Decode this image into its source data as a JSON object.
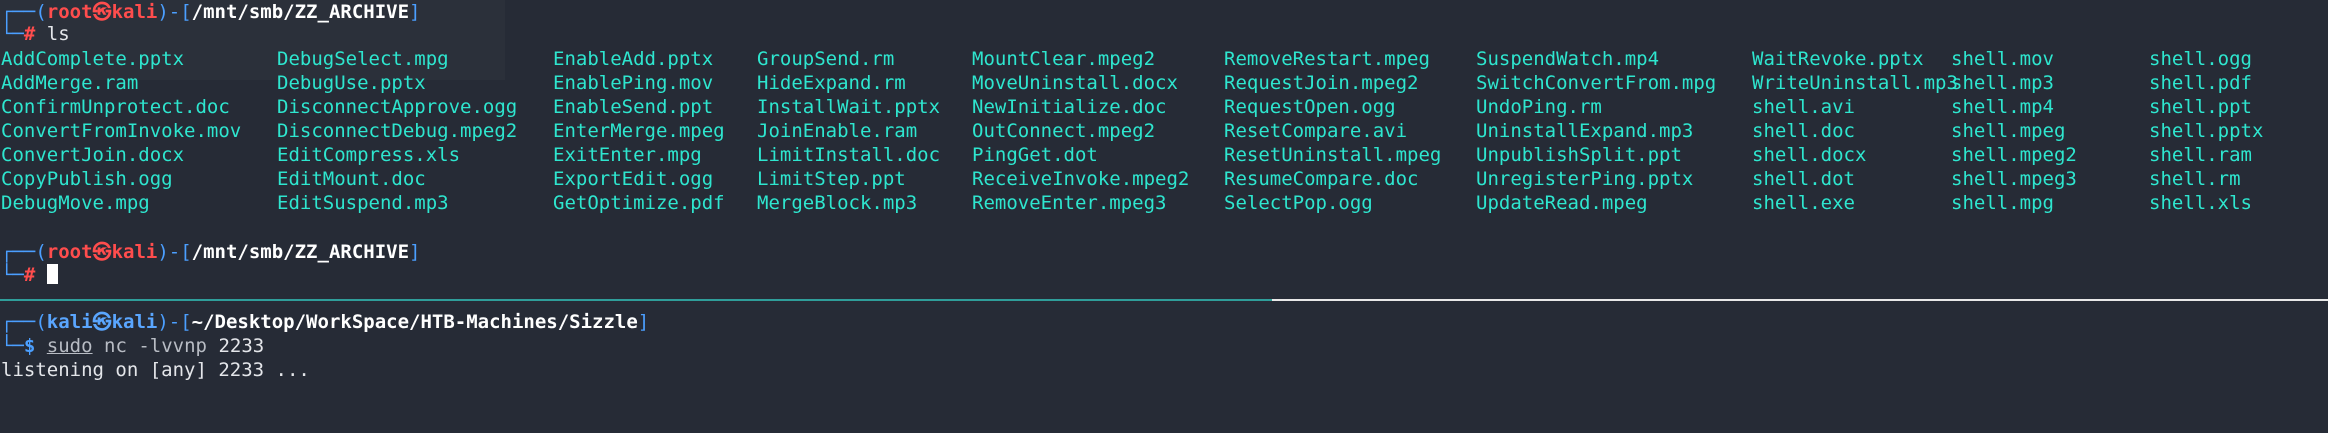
{
  "top_pane": {
    "prompt1": {
      "corner_top": "┌──",
      "open_paren": "(",
      "user": "root",
      "at_symbol": "㉿",
      "host": "kali",
      "close_paren": ")",
      "sep": "-[",
      "path": "/mnt/smb/ZZ_ARCHIVE",
      "close_bracket": "]",
      "corner_bottom": "└─",
      "symbol": "#",
      "command": "ls"
    },
    "files": [
      [
        "AddComplete.pptx",
        "AddMerge.ram",
        "ConfirmUnprotect.doc",
        "ConvertFromInvoke.mov",
        "ConvertJoin.docx",
        "CopyPublish.ogg",
        "DebugMove.mpg"
      ],
      [
        "DebugSelect.mpg",
        "DebugUse.pptx",
        "DisconnectApprove.ogg",
        "DisconnectDebug.mpeg2",
        "EditCompress.xls",
        "EditMount.doc",
        "EditSuspend.mp3"
      ],
      [
        "EnableAdd.pptx",
        "EnablePing.mov",
        "EnableSend.ppt",
        "EnterMerge.mpeg",
        "ExitEnter.mpg",
        "ExportEdit.ogg",
        "GetOptimize.pdf"
      ],
      [
        "GroupSend.rm",
        "HideExpand.rm",
        "InstallWait.pptx",
        "JoinEnable.ram",
        "LimitInstall.doc",
        "LimitStep.ppt",
        "MergeBlock.mp3"
      ],
      [
        "MountClear.mpeg2",
        "MoveUninstall.docx",
        "NewInitialize.doc",
        "OutConnect.mpeg2",
        "PingGet.dot",
        "ReceiveInvoke.mpeg2",
        "RemoveEnter.mpeg3"
      ],
      [
        "RemoveRestart.mpeg",
        "RequestJoin.mpeg2",
        "RequestOpen.ogg",
        "ResetCompare.avi",
        "ResetUninstall.mpeg",
        "ResumeCompare.doc",
        "SelectPop.ogg"
      ],
      [
        "SuspendWatch.mp4",
        "SwitchConvertFrom.mpg",
        "UndoPing.rm",
        "UninstallExpand.mp3",
        "UnpublishSplit.ppt",
        "UnregisterPing.pptx",
        "UpdateRead.mpeg"
      ],
      [
        "WaitRevoke.pptx",
        "WriteUninstall.mp3",
        "shell.avi",
        "shell.doc",
        "shell.docx",
        "shell.dot",
        "shell.exe"
      ],
      [
        "shell.mov",
        "shell.mp3",
        "shell.mp4",
        "shell.mpeg",
        "shell.mpeg2",
        "shell.mpeg3",
        "shell.mpg"
      ],
      [
        "shell.ogg",
        "shell.pdf",
        "shell.ppt",
        "shell.pptx",
        "shell.ram",
        "shell.rm",
        "shell.xls"
      ]
    ],
    "prompt2": {
      "corner_top": "┌──",
      "open_paren": "(",
      "user": "root",
      "at_symbol": "㉿",
      "host": "kali",
      "close_paren": ")",
      "sep": "-[",
      "path": "/mnt/smb/ZZ_ARCHIVE",
      "close_bracket": "]",
      "corner_bottom": "└─",
      "symbol": "#"
    }
  },
  "bottom_pane": {
    "prompt": {
      "corner_top": "┌──",
      "open_paren": "(",
      "user": "kali",
      "at_symbol": "㉿",
      "host": "kali",
      "close_paren": ")",
      "sep": "-[",
      "path": "~/Desktop/WorkSpace/HTB-Machines/Sizzle",
      "close_bracket": "]",
      "corner_bottom": "└─",
      "symbol": "$",
      "sudo": "sudo",
      "cmd_name": "nc",
      "cmd_args": "-lvvnp",
      "cmd_port": "2233"
    },
    "output": "listening on [any] 2233 ..."
  },
  "colors": {
    "background": "#262b36",
    "file_color": "#2ee6cf",
    "root_color": "#ff4d4d",
    "kali_color": "#5aa6ff",
    "divider_teal": "#2f9e9a",
    "divider_white": "#e8e8e8"
  }
}
